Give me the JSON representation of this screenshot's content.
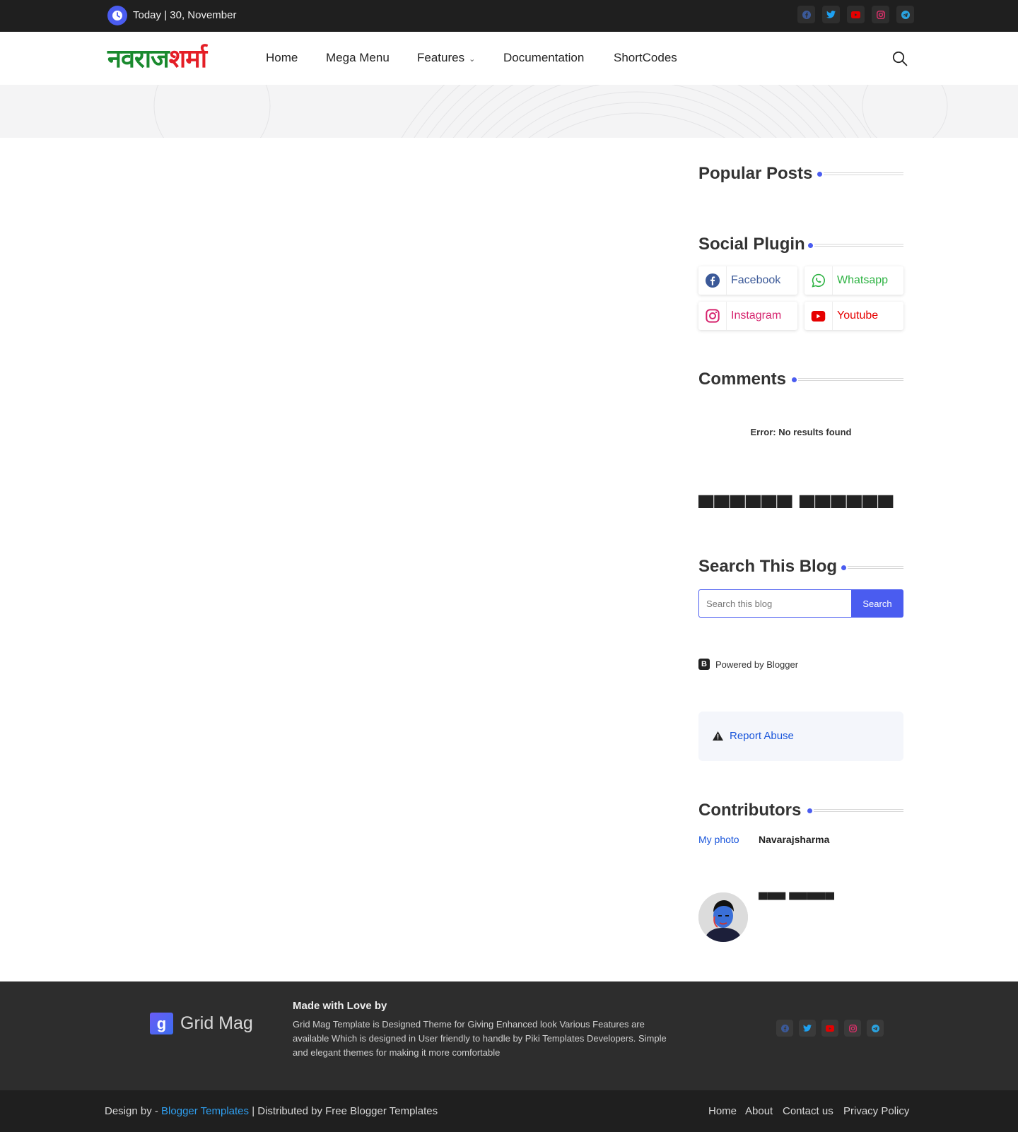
{
  "topbar": {
    "date_text": "Today | 30, November",
    "social": [
      {
        "icon": "facebook-icon",
        "color": "#3b5998"
      },
      {
        "icon": "twitter-icon",
        "color": "#1da1f2"
      },
      {
        "icon": "youtube-icon",
        "color": "#e60000"
      },
      {
        "icon": "instagram-icon",
        "color": "#e1306c"
      },
      {
        "icon": "telegram-icon",
        "color": "#2aa3e0"
      }
    ]
  },
  "header": {
    "logo_part1": "नवराज",
    "logo_part2": "शर्मा",
    "nav": [
      "Home",
      "Mega Menu",
      "Features",
      "Documentation",
      "ShortCodes"
    ]
  },
  "sidebar": {
    "popular_title": "Popular Posts",
    "social_title": "Social Plugin",
    "social_buttons": [
      {
        "label": "Facebook",
        "color": "#3b5998"
      },
      {
        "label": "Whatsapp",
        "color": "#2fb344"
      },
      {
        "label": "Instagram",
        "color": "#d6246e"
      },
      {
        "label": "Youtube",
        "color": "#e60000"
      }
    ],
    "comments_title": "Comments",
    "comments_error": "Error: No results found",
    "unrendered_heading": "▀▀▀▀▀▀ ▀▀▀▀▀▀",
    "search_title": "Search This Blog",
    "search_placeholder": "Search this blog",
    "search_button": "Search",
    "powered_by": "Powered by Blogger",
    "report_abuse": "Report Abuse",
    "contributors_title": "Contributors",
    "contributors": [
      {
        "name": "Navarajsharma",
        "img_alt": "My photo"
      },
      {
        "name": "▀▀▀ ▀▀▀▀▀"
      }
    ]
  },
  "footer": {
    "logo_mark": "g",
    "logo_text": "Grid Mag",
    "made_with": "Made with Love by",
    "description": "Grid Mag Template is Designed Theme for Giving Enhanced look Various Features are available Which is designed in User friendly to handle by Piki Templates Developers. Simple and elegant themes for making it more comfortable",
    "copy_prefix": "Design by -",
    "copy_link": "Blogger Templates",
    "copy_suffix": "| Distributed by Free Blogger Templates",
    "links": [
      "Home",
      "About",
      "Contact us",
      "Privacy Policy"
    ]
  },
  "colors": {
    "accent": "#4a5cf0",
    "topbar_bg": "#1f1f1f",
    "footer_bg": "#2d2d2d"
  }
}
